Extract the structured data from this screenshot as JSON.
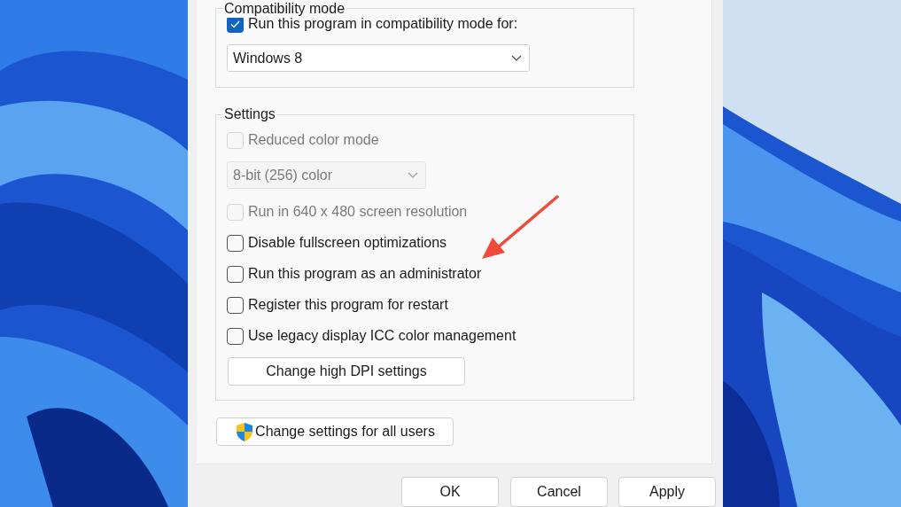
{
  "compatibility_mode": {
    "title": "Compatibility mode",
    "checkbox": {
      "label": "Run this program in compatibility mode for:",
      "checked": true
    },
    "dropdown": {
      "value": "Windows 8",
      "disabled": false
    }
  },
  "settings": {
    "title": "Settings",
    "items": [
      {
        "kind": "checkbox",
        "label": "Reduced color mode",
        "checked": false,
        "disabled": true
      },
      {
        "kind": "dropdown",
        "value": "8-bit (256) color",
        "disabled": true
      },
      {
        "kind": "checkbox",
        "label": "Run in 640 x 480 screen resolution",
        "checked": false,
        "disabled": true
      },
      {
        "kind": "checkbox",
        "label": "Disable fullscreen optimizations",
        "checked": false,
        "disabled": false
      },
      {
        "kind": "checkbox",
        "label": "Run this program as an administrator",
        "checked": false,
        "disabled": false
      },
      {
        "kind": "checkbox",
        "label": "Register this program for restart",
        "checked": false,
        "disabled": false
      },
      {
        "kind": "checkbox",
        "label": "Use legacy display ICC color management",
        "checked": false,
        "disabled": false
      },
      {
        "kind": "button",
        "label": "Change high DPI settings"
      }
    ]
  },
  "all_users_button": {
    "label": "Change settings for all users",
    "shield": true
  },
  "dialog_buttons": [
    "OK",
    "Cancel",
    "Apply"
  ],
  "annotation": {
    "kind": "arrow"
  }
}
